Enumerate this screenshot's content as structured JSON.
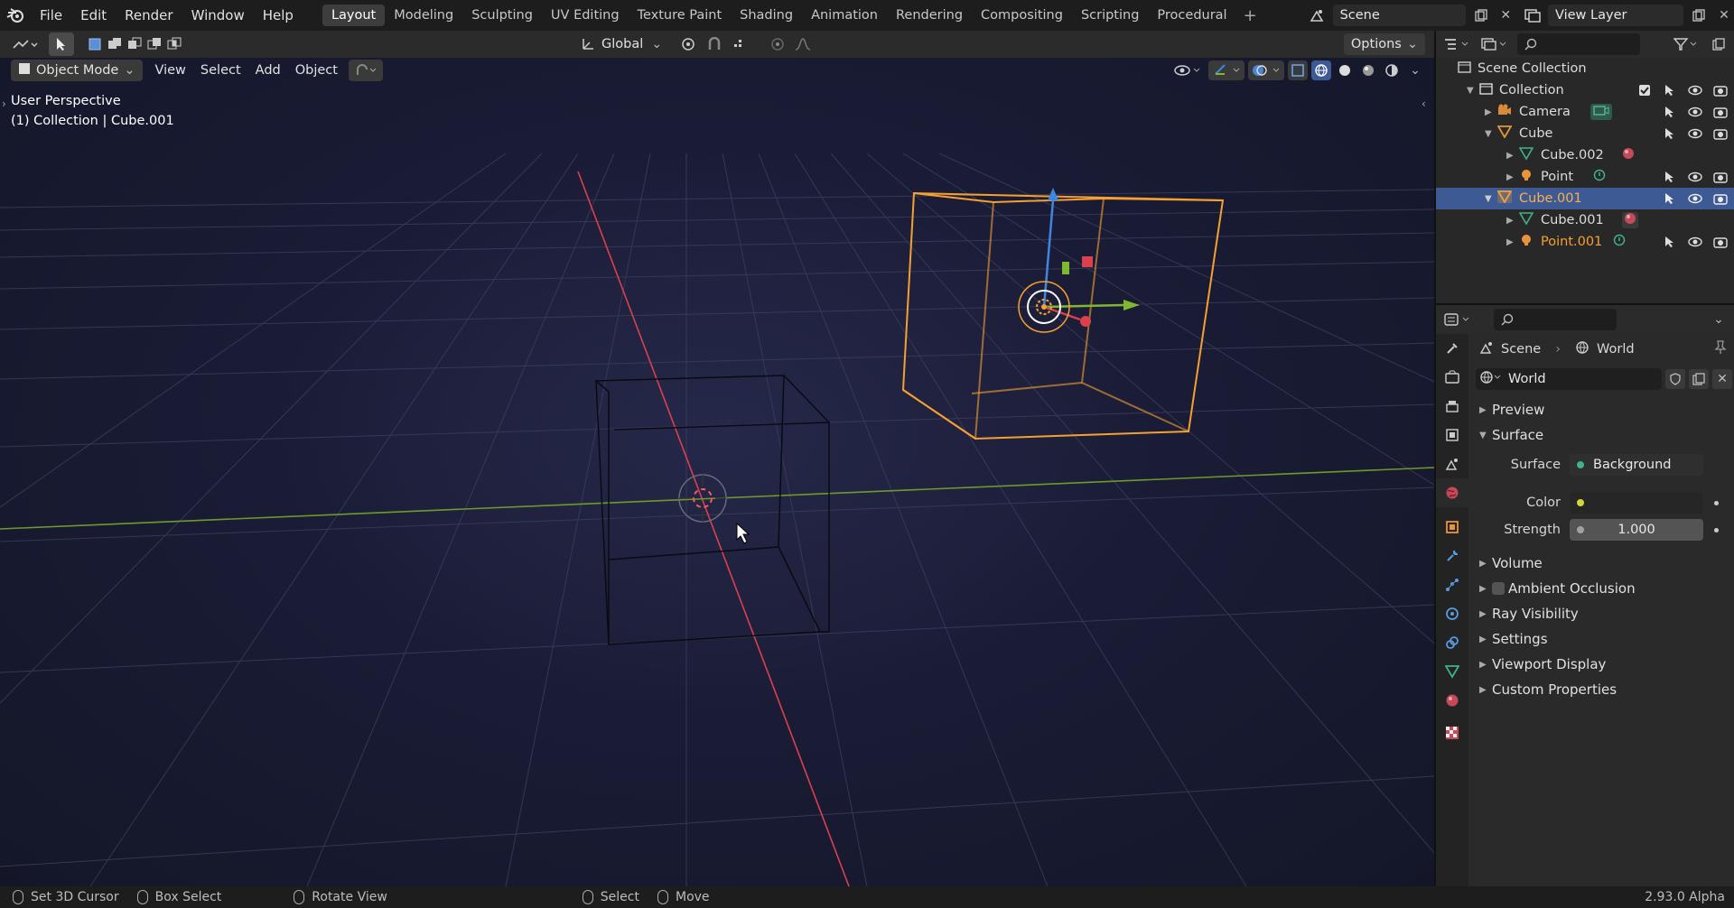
{
  "menubar": {
    "items": [
      "File",
      "Edit",
      "Render",
      "Window",
      "Help"
    ],
    "workspaces": [
      "Layout",
      "Modeling",
      "Sculpting",
      "UV Editing",
      "Texture Paint",
      "Shading",
      "Animation",
      "Rendering",
      "Compositing",
      "Scripting",
      "Procedural"
    ],
    "scene": "Scene",
    "view_layer": "View Layer"
  },
  "toolbar": {
    "transform_orientation": "Global",
    "options": "Options",
    "mode": "Object Mode",
    "view": "View",
    "select": "Select",
    "add": "Add",
    "object": "Object"
  },
  "viewport": {
    "perspective": "User Perspective",
    "context": "(1) Collection | Cube.001"
  },
  "outliner": {
    "root": "Scene Collection",
    "rows": [
      {
        "label": "Collection"
      },
      {
        "label": "Camera"
      },
      {
        "label": "Cube"
      },
      {
        "label": "Cube.002"
      },
      {
        "label": "Point"
      },
      {
        "label": "Cube.001"
      },
      {
        "label": "Cube.001"
      },
      {
        "label": "Point.001"
      }
    ]
  },
  "properties": {
    "breadcrumb_scene": "Scene",
    "breadcrumb_world": "World",
    "world_name": "World",
    "panels": {
      "preview": "Preview",
      "surface": "Surface",
      "volume": "Volume",
      "ambient_occlusion": "Ambient Occlusion",
      "ray_visibility": "Ray Visibility",
      "settings": "Settings",
      "viewport_display": "Viewport Display",
      "custom_properties": "Custom Properties"
    },
    "surface_label": "Surface",
    "surface_value": "Background",
    "color_label": "Color",
    "strength_label": "Strength",
    "strength_value": "1.000"
  },
  "statusbar": {
    "set_cursor": "Set 3D Cursor",
    "box_select": "Box Select",
    "rotate_view": "Rotate View",
    "select": "Select",
    "move": "Move",
    "version": "2.93.0 Alpha"
  },
  "colors": {
    "accent_selected": "#3d5a94",
    "active_object": "#f5a030",
    "x_axis": "#d9414d",
    "y_axis": "#7fb82e",
    "z_axis": "#3e87e0"
  }
}
